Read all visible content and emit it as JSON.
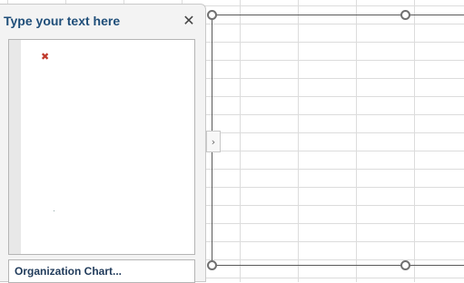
{
  "text_pane": {
    "title": "Type your text here",
    "close_glyph": "✕",
    "bullet_glyph": "✖",
    "footer_label": "Organization Chart..."
  },
  "canvas": {
    "expand_glyph": "›"
  }
}
